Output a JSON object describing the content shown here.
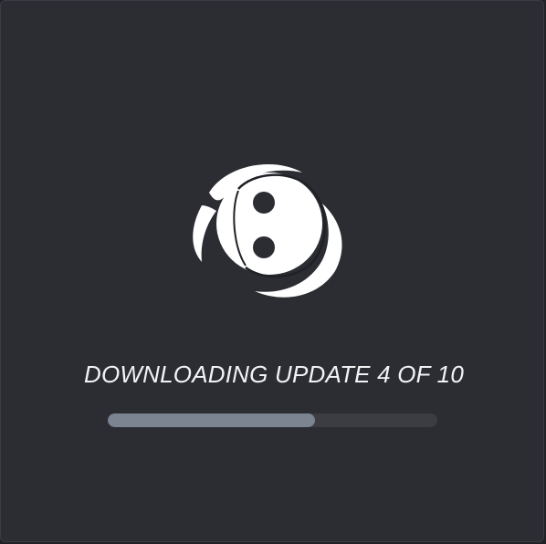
{
  "updater": {
    "status_text": "DOWNLOADING UPDATE 4 OF 10",
    "progress_fraction": 0.63,
    "logo_icon": "discord-swirl-logo-icon"
  },
  "colors": {
    "background": "#2b2d33",
    "text": "#f2f3f5",
    "progress_track": "#3b3d43",
    "progress_fill": "#7c8391",
    "logo": "#ffffff"
  }
}
